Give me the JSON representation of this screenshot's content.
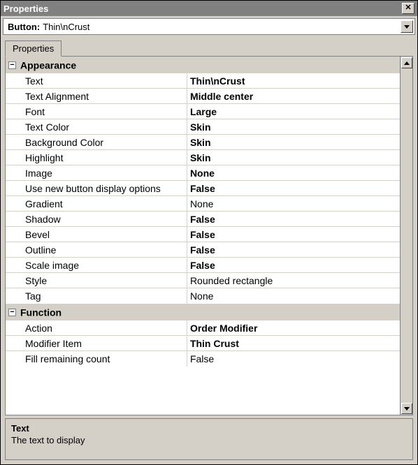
{
  "window": {
    "title": "Properties",
    "close_glyph": "✕"
  },
  "selector": {
    "label": "Button:",
    "value": "Thin\\nCrust"
  },
  "tabs": {
    "properties": "Properties"
  },
  "categories": [
    {
      "name": "Appearance",
      "expander": "−",
      "rows": [
        {
          "name": "Text",
          "value": "Thin\\nCrust",
          "bold": true
        },
        {
          "name": "Text Alignment",
          "value": "Middle center",
          "bold": true
        },
        {
          "name": "Font",
          "value": "Large",
          "bold": true
        },
        {
          "name": "Text Color",
          "value": "Skin",
          "bold": true
        },
        {
          "name": "Background Color",
          "value": "Skin",
          "bold": true
        },
        {
          "name": "Highlight",
          "value": "Skin",
          "bold": true
        },
        {
          "name": "Image",
          "value": "None",
          "bold": true
        },
        {
          "name": "Use new button display options",
          "value": "False",
          "bold": true
        },
        {
          "name": "Gradient",
          "value": "None",
          "bold": false
        },
        {
          "name": "Shadow",
          "value": "False",
          "bold": true
        },
        {
          "name": "Bevel",
          "value": "False",
          "bold": true
        },
        {
          "name": "Outline",
          "value": "False",
          "bold": true
        },
        {
          "name": "Scale image",
          "value": "False",
          "bold": true
        },
        {
          "name": "Style",
          "value": "Rounded rectangle",
          "bold": false
        },
        {
          "name": "Tag",
          "value": "None",
          "bold": false
        }
      ]
    },
    {
      "name": "Function",
      "expander": "−",
      "rows": [
        {
          "name": "Action",
          "value": "Order Modifier",
          "bold": true
        },
        {
          "name": "Modifier Item",
          "value": "Thin Crust",
          "bold": true
        },
        {
          "name": "Fill remaining count",
          "value": "False",
          "bold": false
        }
      ]
    }
  ],
  "description": {
    "title": "Text",
    "body": "The text to display"
  }
}
